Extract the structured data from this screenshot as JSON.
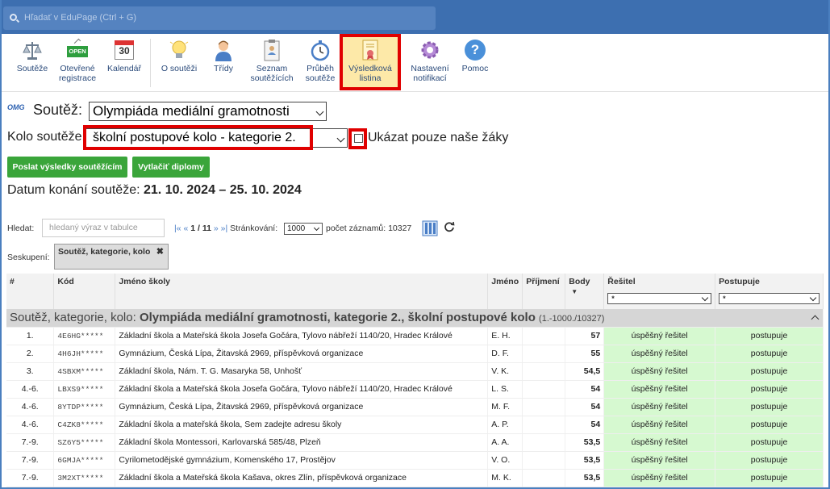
{
  "search": {
    "placeholder": "Hľadať v EduPage (Ctrl + G)"
  },
  "toolbar": {
    "items": [
      {
        "label1": "Soutěže",
        "label2": "",
        "icon": "scales-icon"
      },
      {
        "label1": "Otevřené",
        "label2": "registrace",
        "icon": "open-sign-icon",
        "badge": "OPEN"
      },
      {
        "label1": "Kalendář",
        "label2": "",
        "icon": "calendar-icon",
        "badge": "30"
      },
      {
        "label1": "O soutěži",
        "label2": "",
        "icon": "lightbulb-icon"
      },
      {
        "label1": "Třídy",
        "label2": "",
        "icon": "person-icon"
      },
      {
        "label1": "Seznam",
        "label2": "soutěžících",
        "icon": "clipboard-icon"
      },
      {
        "label1": "Průběh",
        "label2": "soutěže",
        "icon": "stopwatch-icon"
      },
      {
        "label1": "Výsledková",
        "label2": "listina",
        "icon": "certificate-icon"
      },
      {
        "label1": "Nastavení",
        "label2": "notifikací",
        "icon": "gear-icon"
      },
      {
        "label1": "Pomoc",
        "label2": "",
        "icon": "help-icon",
        "badge": "?"
      }
    ]
  },
  "logo": "OMG",
  "competition": {
    "label": "Soutěž:",
    "value": "Olympiáda mediální gramotnosti"
  },
  "round": {
    "label": "Kolo soutěže:",
    "value": "školní postupové kolo - kategorie 2.",
    "checkbox_label": "Ukázat pouze naše žáky"
  },
  "buttons": {
    "send_results": "Poslat výsledky soutěžícím",
    "print_diplomas": "Vytlačiť diplomy"
  },
  "date": {
    "label": "Datum konání soutěže:",
    "value": "21. 10. 2024 – 25. 10. 2024"
  },
  "filter": {
    "label": "Hledat:",
    "placeholder": "hledaný výraz v tabulce",
    "pager_first": "|«",
    "pager_prev": "«",
    "page": "1",
    "page_sep": "/",
    "pages": "11",
    "pager_next": "»",
    "pager_last": "»|",
    "paging_label": "Stránkování:",
    "paging_value": "1000",
    "count_label": "počet záznamů:",
    "count_value": "10327"
  },
  "grouping": {
    "label": "Seskupení:",
    "chip": "Soutěž, kategorie, kolo"
  },
  "table": {
    "headers": [
      "#",
      "Kód",
      "Jméno školy",
      "Jméno",
      "Příjmení",
      "Body",
      "Řešitel",
      "Postupuje"
    ],
    "filter_value": "*",
    "group_prefix": "Soutěž, kategorie, kolo:",
    "group_title": "Olympiáda mediální gramotnosti, kategorie 2., školní postupové kolo",
    "group_range": "(1.-1000./10327)",
    "rows": [
      {
        "rank": "1.",
        "code": "4E6HG*****",
        "school": "Základní škola a Mateřská škola Josefa Gočára, Tylovo nábřeží 1140/20, Hradec Králové",
        "name": "E. H.",
        "surname": "",
        "points": "57",
        "solver": "úspěšný řešitel",
        "advances": "postupuje"
      },
      {
        "rank": "2.",
        "code": "4H6JH*****",
        "school": "Gymnázium, Česká Lípa, Žitavská 2969, příspěvková organizace",
        "name": "D. F.",
        "surname": "",
        "points": "55",
        "solver": "úspěšný řešitel",
        "advances": "postupuje"
      },
      {
        "rank": "3.",
        "code": "4SBXM*****",
        "school": "Základní škola, Nám. T. G. Masaryka 58, Unhošť",
        "name": "V. K.",
        "surname": "",
        "points": "54,5",
        "solver": "úspěšný řešitel",
        "advances": "postupuje"
      },
      {
        "rank": "4.-6.",
        "code": "LBXS9*****",
        "school": "Základní škola a Mateřská škola Josefa Gočára, Tylovo nábřeží 1140/20, Hradec Králové",
        "name": "L. S.",
        "surname": "",
        "points": "54",
        "solver": "úspěšný řešitel",
        "advances": "postupuje"
      },
      {
        "rank": "4.-6.",
        "code": "8YTDP*****",
        "school": "Gymnázium, Česká Lípa, Žitavská 2969, příspěvková organizace",
        "name": "M. F.",
        "surname": "",
        "points": "54",
        "solver": "úspěšný řešitel",
        "advances": "postupuje"
      },
      {
        "rank": "4.-6.",
        "code": "C4ZK8*****",
        "school": "Základní škola a mateřská škola, Sem zadejte adresu školy",
        "name": "A. P.",
        "surname": "",
        "points": "54",
        "solver": "úspěšný řešitel",
        "advances": "postupuje"
      },
      {
        "rank": "7.-9.",
        "code": "SZ6Y5*****",
        "school": "Základní škola Montessori, Karlovarská 585/48, Plzeň",
        "name": "A. A.",
        "surname": "",
        "points": "53,5",
        "solver": "úspěšný řešitel",
        "advances": "postupuje"
      },
      {
        "rank": "7.-9.",
        "code": "6GMJA*****",
        "school": "Cyrilometodějské gymnázium, Komenského 17, Prostějov",
        "name": "V. O.",
        "surname": "",
        "points": "53,5",
        "solver": "úspěšný řešitel",
        "advances": "postupuje"
      },
      {
        "rank": "7.-9.",
        "code": "3M2XT*****",
        "school": "Základní škola a Mateřská škola Kašava, okres Zlín, příspěvková organizace",
        "name": "M. K.",
        "surname": "",
        "points": "53,5",
        "solver": "úspěšný řešitel",
        "advances": "postupuje"
      }
    ]
  },
  "colors": {
    "topbar": "#3d6fb0",
    "accent_red": "#e00000",
    "button_green": "#3aa53a",
    "success_bg": "#d6f9d0",
    "active_bg": "#fde9a8"
  }
}
